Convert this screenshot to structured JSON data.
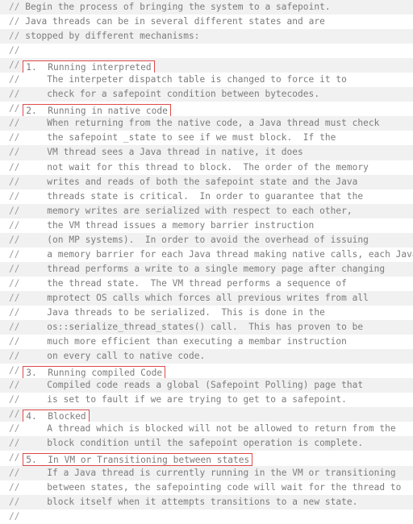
{
  "editor": {
    "name": "source-code-comment-block",
    "language": "java-cpp-comment",
    "colors": {
      "background": "#ffffff",
      "stripe": "#f1f1f1",
      "text": "#7c7c7c",
      "comment_marker": "#9b9b9b",
      "highlight_border": "#e04a4a"
    },
    "line_count": 36,
    "lines": [
      {
        "marker": "//",
        "indent": 1,
        "text": "Begin the process of bringing the system to a safepoint.",
        "boxed": false
      },
      {
        "marker": "//",
        "indent": 1,
        "text": "Java threads can be in several different states and are",
        "boxed": false
      },
      {
        "marker": "//",
        "indent": 1,
        "text": "stopped by different mechanisms:",
        "boxed": false
      },
      {
        "marker": "//",
        "indent": 0,
        "text": "",
        "boxed": false
      },
      {
        "marker": "//",
        "indent": 1,
        "text": "1.  Running interpreted",
        "boxed": true
      },
      {
        "marker": "//",
        "indent": 5,
        "text": "The interpeter dispatch table is changed to force it to",
        "boxed": false
      },
      {
        "marker": "//",
        "indent": 5,
        "text": "check for a safepoint condition between bytecodes.",
        "boxed": false
      },
      {
        "marker": "//",
        "indent": 1,
        "text": "2.  Running in native code",
        "boxed": true
      },
      {
        "marker": "//",
        "indent": 5,
        "text": "When returning from the native code, a Java thread must check",
        "boxed": false
      },
      {
        "marker": "//",
        "indent": 5,
        "text": "the safepoint _state to see if we must block.  If the",
        "boxed": false
      },
      {
        "marker": "//",
        "indent": 5,
        "text": "VM thread sees a Java thread in native, it does",
        "boxed": false
      },
      {
        "marker": "//",
        "indent": 5,
        "text": "not wait for this thread to block.  The order of the memory",
        "boxed": false
      },
      {
        "marker": "//",
        "indent": 5,
        "text": "writes and reads of both the safepoint state and the Java",
        "boxed": false
      },
      {
        "marker": "//",
        "indent": 5,
        "text": "threads state is critical.  In order to guarantee that the",
        "boxed": false
      },
      {
        "marker": "//",
        "indent": 5,
        "text": "memory writes are serialized with respect to each other,",
        "boxed": false
      },
      {
        "marker": "//",
        "indent": 5,
        "text": "the VM thread issues a memory barrier instruction",
        "boxed": false
      },
      {
        "marker": "//",
        "indent": 5,
        "text": "(on MP systems).  In order to avoid the overhead of issuing",
        "boxed": false
      },
      {
        "marker": "//",
        "indent": 5,
        "text": "a memory barrier for each Java thread making native calls, each Java",
        "boxed": false
      },
      {
        "marker": "//",
        "indent": 5,
        "text": "thread performs a write to a single memory page after changing",
        "boxed": false
      },
      {
        "marker": "//",
        "indent": 5,
        "text": "the thread state.  The VM thread performs a sequence of",
        "boxed": false
      },
      {
        "marker": "//",
        "indent": 5,
        "text": "mprotect OS calls which forces all previous writes from all",
        "boxed": false
      },
      {
        "marker": "//",
        "indent": 5,
        "text": "Java threads to be serialized.  This is done in the",
        "boxed": false
      },
      {
        "marker": "//",
        "indent": 5,
        "text": "os::serialize_thread_states() call.  This has proven to be",
        "boxed": false
      },
      {
        "marker": "//",
        "indent": 5,
        "text": "much more efficient than executing a membar instruction",
        "boxed": false
      },
      {
        "marker": "//",
        "indent": 5,
        "text": "on every call to native code.",
        "boxed": false
      },
      {
        "marker": "//",
        "indent": 1,
        "text": "3.  Running compiled Code",
        "boxed": true
      },
      {
        "marker": "//",
        "indent": 5,
        "text": "Compiled code reads a global (Safepoint Polling) page that",
        "boxed": false
      },
      {
        "marker": "//",
        "indent": 5,
        "text": "is set to fault if we are trying to get to a safepoint.",
        "boxed": false
      },
      {
        "marker": "//",
        "indent": 1,
        "text": "4.  Blocked",
        "boxed": true
      },
      {
        "marker": "//",
        "indent": 5,
        "text": "A thread which is blocked will not be allowed to return from the",
        "boxed": false
      },
      {
        "marker": "//",
        "indent": 5,
        "text": "block condition until the safepoint operation is complete.",
        "boxed": false
      },
      {
        "marker": "//",
        "indent": 1,
        "text": "5.  In VM or Transitioning between states",
        "boxed": true
      },
      {
        "marker": "//",
        "indent": 5,
        "text": "If a Java thread is currently running in the VM or transitioning",
        "boxed": false
      },
      {
        "marker": "//",
        "indent": 5,
        "text": "between states, the safepointing code will wait for the thread to",
        "boxed": false
      },
      {
        "marker": "//",
        "indent": 5,
        "text": "block itself when it attempts transitions to a new state.",
        "boxed": false
      },
      {
        "marker": "//",
        "indent": 0,
        "text": "",
        "boxed": false
      }
    ]
  }
}
